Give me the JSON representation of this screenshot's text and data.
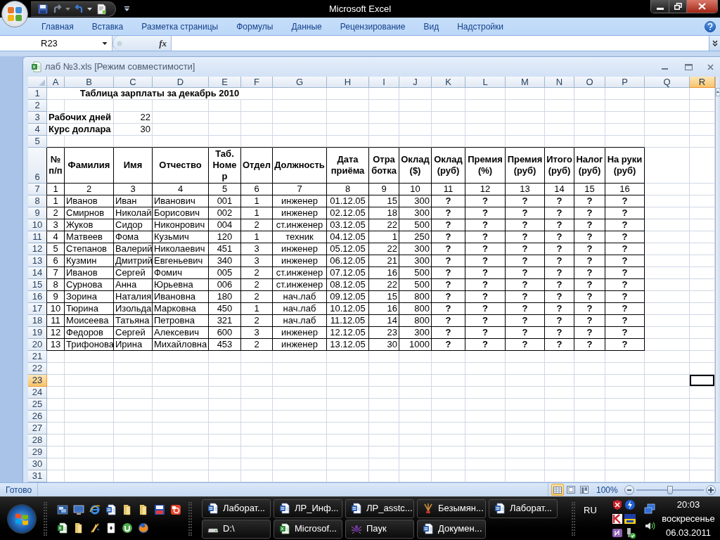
{
  "window": {
    "title": "Microsoft Excel"
  },
  "ribbon_tabs": [
    "Главная",
    "Вставка",
    "Разметка страницы",
    "Формулы",
    "Данные",
    "Рецензирование",
    "Вид",
    "Надстройки"
  ],
  "formula_bar": {
    "name_box": "R23",
    "function_label": "fx"
  },
  "workbook": {
    "title": "лаб №3.xls [Режим совместимости]",
    "columns": [
      {
        "letter": "A",
        "selected": false
      },
      {
        "letter": "B",
        "selected": false
      },
      {
        "letter": "C",
        "selected": false
      },
      {
        "letter": "D",
        "selected": false
      },
      {
        "letter": "E",
        "selected": false
      },
      {
        "letter": "F",
        "selected": false
      },
      {
        "letter": "G",
        "selected": false
      },
      {
        "letter": "H",
        "selected": false
      },
      {
        "letter": "I",
        "selected": false
      },
      {
        "letter": "J",
        "selected": false
      },
      {
        "letter": "K",
        "selected": false
      },
      {
        "letter": "L",
        "selected": false
      },
      {
        "letter": "M",
        "selected": false
      },
      {
        "letter": "N",
        "selected": false
      },
      {
        "letter": "O",
        "selected": false
      },
      {
        "letter": "P",
        "selected": false
      },
      {
        "letter": "Q",
        "selected": false
      },
      {
        "letter": "R",
        "selected": true
      }
    ],
    "rows": [
      {
        "number": "1",
        "selected": false
      },
      {
        "number": "2",
        "selected": false
      },
      {
        "number": "3",
        "selected": false
      },
      {
        "number": "4",
        "selected": false
      },
      {
        "number": "5",
        "selected": false
      },
      {
        "number": "6",
        "selected": false
      },
      {
        "number": "7",
        "selected": false
      },
      {
        "number": "8",
        "selected": false
      },
      {
        "number": "9",
        "selected": false
      },
      {
        "number": "10",
        "selected": false
      },
      {
        "number": "11",
        "selected": false
      },
      {
        "number": "12",
        "selected": false
      },
      {
        "number": "13",
        "selected": false
      },
      {
        "number": "14",
        "selected": false
      },
      {
        "number": "15",
        "selected": false
      },
      {
        "number": "16",
        "selected": false
      },
      {
        "number": "17",
        "selected": false
      },
      {
        "number": "18",
        "selected": false
      },
      {
        "number": "19",
        "selected": false
      },
      {
        "number": "20",
        "selected": false
      },
      {
        "number": "21",
        "selected": false
      },
      {
        "number": "22",
        "selected": false
      },
      {
        "number": "23",
        "selected": true
      },
      {
        "number": "24",
        "selected": false
      },
      {
        "number": "25",
        "selected": false
      },
      {
        "number": "26",
        "selected": false
      },
      {
        "number": "27",
        "selected": false
      },
      {
        "number": "28",
        "selected": false
      },
      {
        "number": "29",
        "selected": false
      },
      {
        "number": "30",
        "selected": false
      },
      {
        "number": "31",
        "selected": false
      }
    ],
    "sheet_title": "Таблица зарплаты за декабрь 2010",
    "parameters": [
      {
        "label": "Рабочих дней",
        "value": "22"
      },
      {
        "label": "Курс доллара",
        "value": "30"
      }
    ],
    "salary_table": {
      "headings": [
        "№ п/п",
        "Фамилия",
        "Имя",
        "Отчество",
        "Таб. Номер",
        "Отдел",
        "Должность",
        "Дата приёма",
        "Отработка",
        "Оклад ($)",
        "Оклад (руб)",
        "Премия (%)",
        "Премия (руб)",
        "Итого (руб)",
        "Налог (руб)",
        "На руки (руб)"
      ],
      "column_numbers": [
        "1",
        "2",
        "3",
        "4",
        "5",
        "6",
        "7",
        "8",
        "9",
        "10",
        "11",
        "12",
        "13",
        "14",
        "15",
        "16"
      ],
      "rows": [
        [
          "1",
          "Иванов",
          "Иван",
          "Иванович",
          "001",
          "1",
          "инженер",
          "01.12.05",
          "15",
          "300",
          "?",
          "?",
          "?",
          "?",
          "?",
          "?"
        ],
        [
          "2",
          "Смирнов",
          "Николай",
          "Борисович",
          "002",
          "1",
          "инженер",
          "02.12.05",
          "18",
          "300",
          "?",
          "?",
          "?",
          "?",
          "?",
          "?"
        ],
        [
          "3",
          "Жуков",
          "Сидор",
          "Никонрович",
          "004",
          "2",
          "ст.инженер",
          "03.12.05",
          "22",
          "500",
          "?",
          "?",
          "?",
          "?",
          "?",
          "?"
        ],
        [
          "4",
          "Матвеев",
          "Фома",
          "Кузьмич",
          "120",
          "1",
          "техник",
          "04.12.05",
          "1",
          "250",
          "?",
          "?",
          "?",
          "?",
          "?",
          "?"
        ],
        [
          "5",
          "Степанов",
          "Валерий",
          "Николаевич",
          "451",
          "3",
          "инженер",
          "05.12.05",
          "22",
          "300",
          "?",
          "?",
          "?",
          "?",
          "?",
          "?"
        ],
        [
          "6",
          "Кузмин",
          "Дмитрий",
          "Евгеньевич",
          "340",
          "3",
          "инженер",
          "06.12.05",
          "21",
          "300",
          "?",
          "?",
          "?",
          "?",
          "?",
          "?"
        ],
        [
          "7",
          "Иванов",
          "Сергей",
          "Фомич",
          "005",
          "2",
          "ст.инженер",
          "07.12.05",
          "16",
          "500",
          "?",
          "?",
          "?",
          "?",
          "?",
          "?"
        ],
        [
          "8",
          "Сурнова",
          "Анна",
          "Юрьевна",
          "006",
          "2",
          "ст.инженер",
          "08.12.05",
          "22",
          "500",
          "?",
          "?",
          "?",
          "?",
          "?",
          "?"
        ],
        [
          "9",
          "Зорина",
          "Наталия",
          "Ивановна",
          "180",
          "2",
          "нач.лаб",
          "09.12.05",
          "15",
          "800",
          "?",
          "?",
          "?",
          "?",
          "?",
          "?"
        ],
        [
          "10",
          "Тюрина",
          "Изольда",
          "Марковна",
          "450",
          "1",
          "нач.лаб",
          "10.12.05",
          "16",
          "800",
          "?",
          "?",
          "?",
          "?",
          "?",
          "?"
        ],
        [
          "11",
          "Моисеева",
          "Татьяна",
          "Петровна",
          "321",
          "2",
          "нач.лаб",
          "11.12.05",
          "14",
          "800",
          "?",
          "?",
          "?",
          "?",
          "?",
          "?"
        ],
        [
          "12",
          "Федоров",
          "Сергей",
          "Алексевич",
          "600",
          "3",
          "инженер",
          "12.12.05",
          "23",
          "300",
          "?",
          "?",
          "?",
          "?",
          "?",
          "?"
        ],
        [
          "13",
          "Трифонова",
          "Ирина",
          "Михайловна",
          "453",
          "2",
          "инженер",
          "13.12.05",
          "30",
          "1000",
          "?",
          "?",
          "?",
          "?",
          "?",
          "?"
        ]
      ]
    }
  },
  "status_bar": {
    "status": "Готово",
    "view_buttons": [
      {
        "kind": "normal",
        "selected": true
      },
      {
        "kind": "page_layout",
        "selected": false
      },
      {
        "kind": "page_break",
        "selected": false
      }
    ],
    "zoom": "100%",
    "zoom_slider": {
      "level": 0.5
    }
  },
  "taskbar": {
    "buttons": [
      {
        "label": "Лаборат...",
        "kind": "document"
      },
      {
        "label": "ЛР_Инф...",
        "kind": "document"
      },
      {
        "label": "ЛР_asstc...",
        "kind": "document"
      },
      {
        "label": "Безымян...",
        "kind": "paint"
      },
      {
        "label": "Лаборат...",
        "kind": "document"
      },
      {
        "label": "D:\\",
        "kind": "drive"
      },
      {
        "label": "Microsof...",
        "kind": "spreadsheet"
      },
      {
        "label": "Паук",
        "kind": "spider"
      },
      {
        "label": "Докумен...",
        "kind": "document"
      }
    ],
    "language": "RU",
    "clock": {
      "time": "20:03",
      "day": "воскресенье",
      "date": "06.03.2011"
    }
  }
}
